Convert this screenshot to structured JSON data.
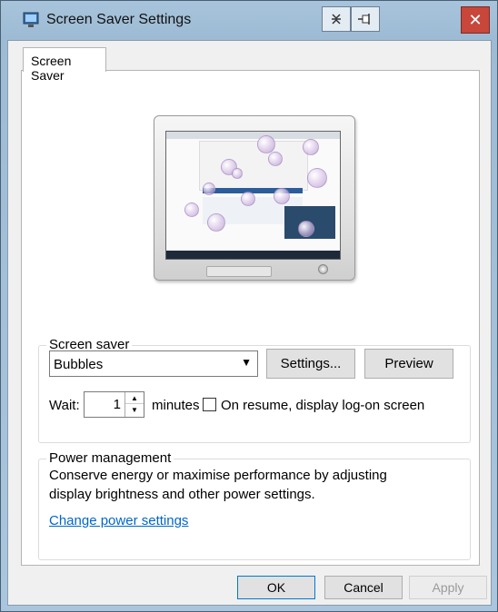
{
  "window": {
    "title": "Screen Saver Settings",
    "close_glyph": "✕",
    "tb_buttons": [
      "collapse-icon",
      "pin-icon"
    ]
  },
  "tab": {
    "label": "Screen Saver"
  },
  "screen_saver": {
    "group_label": "Screen saver",
    "selected": "Bubbles",
    "settings_label": "Settings...",
    "preview_label": "Preview",
    "wait_label": "Wait:",
    "wait_value": "1",
    "minutes_label": "minutes",
    "resume_label": "On resume, display log-on screen",
    "resume_checked": false
  },
  "power": {
    "group_label": "Power management",
    "desc_line1": "Conserve energy or maximise performance by adjusting",
    "desc_line2": "display brightness and other power settings.",
    "link_label": "Change power settings"
  },
  "footer": {
    "ok_label": "OK",
    "cancel_label": "Cancel",
    "apply_label": "Apply"
  },
  "colors": {
    "accent": "#0078d7",
    "link": "#0066cc",
    "close": "#c8463a"
  }
}
